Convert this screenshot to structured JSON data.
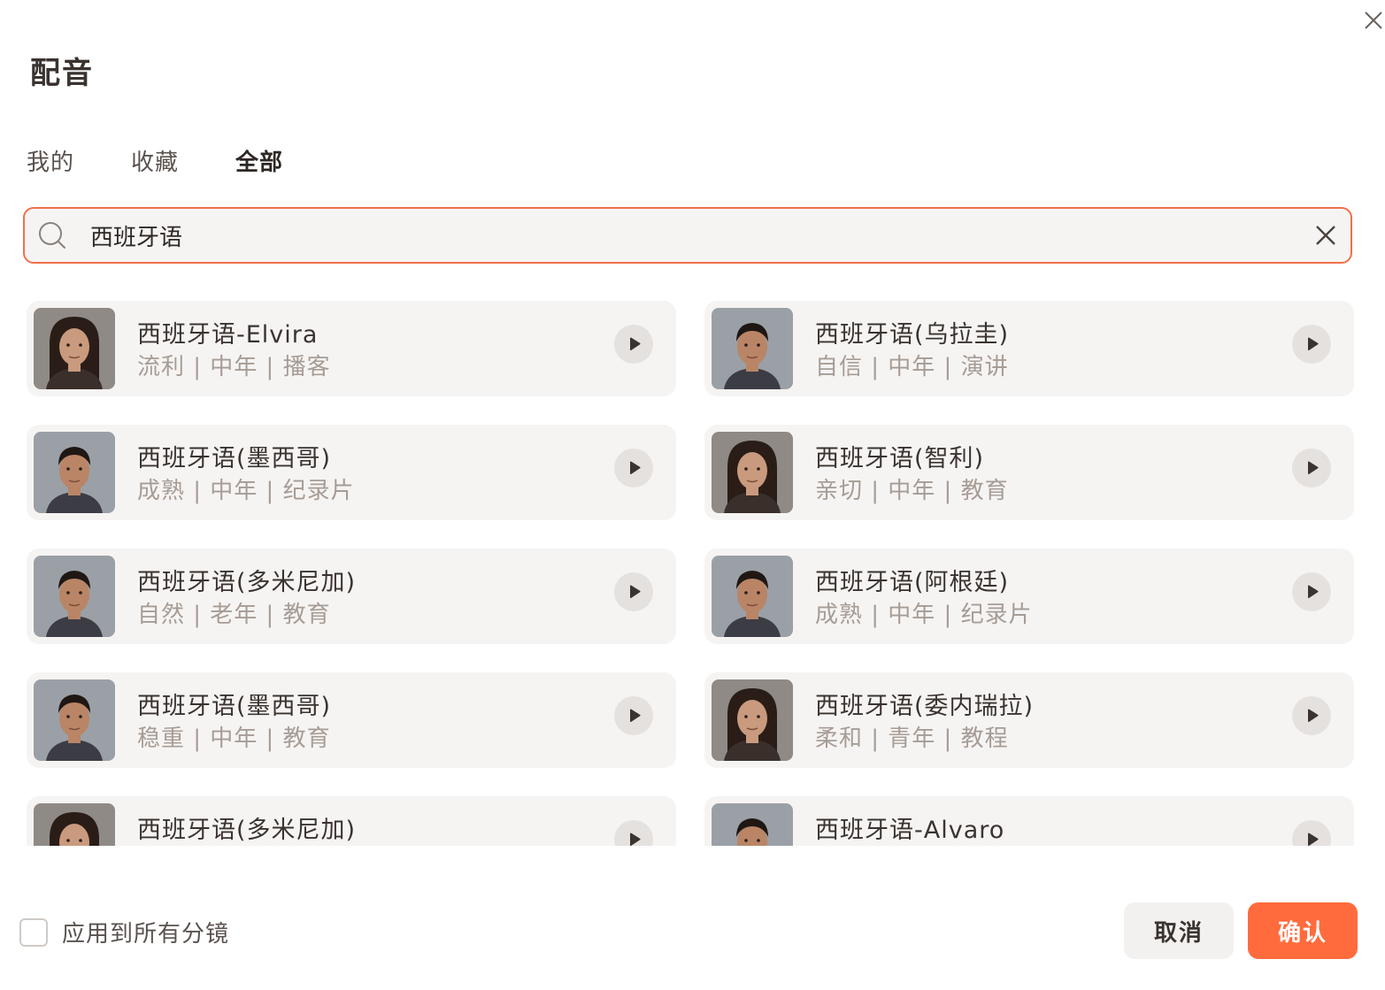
{
  "dialog": {
    "title": "配音"
  },
  "tabs": [
    {
      "label": "我的",
      "active": false
    },
    {
      "label": "收藏",
      "active": false
    },
    {
      "label": "全部",
      "active": true
    }
  ],
  "search": {
    "value": "西班牙语",
    "icon": "search-icon",
    "clear_icon": "close-icon"
  },
  "voices": [
    {
      "name": "西班牙语-Elvira",
      "tags": "流利 | 中年 | 播客",
      "avatar": "female-portrait"
    },
    {
      "name": "西班牙语(乌拉圭)",
      "tags": "自信 | 中年 | 演讲",
      "avatar": "male-portrait"
    },
    {
      "name": "西班牙语(墨西哥)",
      "tags": "成熟 | 中年 | 纪录片",
      "avatar": "male-portrait"
    },
    {
      "name": "西班牙语(智利)",
      "tags": "亲切 | 中年 | 教育",
      "avatar": "female-portrait"
    },
    {
      "name": "西班牙语(多米尼加)",
      "tags": "自然 | 老年 | 教育",
      "avatar": "male-portrait"
    },
    {
      "name": "西班牙语(阿根廷)",
      "tags": "成熟 | 中年 | 纪录片",
      "avatar": "male-portrait"
    },
    {
      "name": "西班牙语(墨西哥)",
      "tags": "稳重 | 中年 | 教育",
      "avatar": "male-portrait"
    },
    {
      "name": "西班牙语(委内瑞拉)",
      "tags": "柔和 | 青年 | 教程",
      "avatar": "female-portrait"
    },
    {
      "name": "西班牙语(多米尼加)",
      "tags": "",
      "avatar": "female-portrait"
    },
    {
      "name": "西班牙语-Alvaro",
      "tags": "",
      "avatar": "male-portrait"
    }
  ],
  "footer": {
    "apply_all_label": "应用到所有分镜",
    "apply_all_checked": false,
    "cancel_label": "取消",
    "confirm_label": "确认"
  },
  "colors": {
    "accent": "#ff6b3d",
    "search_border": "#f0704a",
    "card_bg": "#f6f4f2",
    "tag_text": "#a69c96"
  }
}
